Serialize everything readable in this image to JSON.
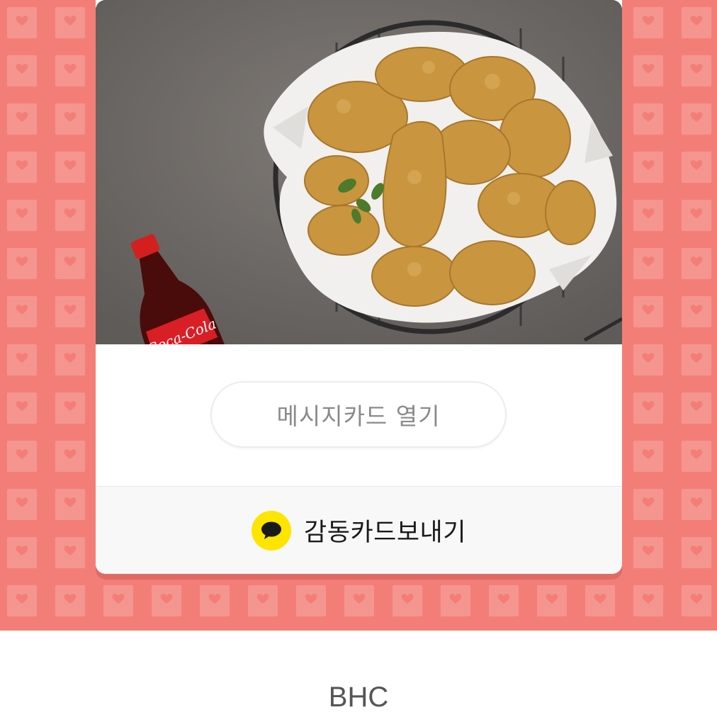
{
  "card": {
    "photo_label": "Coca-Cola",
    "open_button_label": "메시지카드 열기",
    "send_button_label": "감동카드보내기",
    "send_icon": "kakaotalk-speech-bubble-icon"
  },
  "footer": {
    "brand": "BHC"
  },
  "colors": {
    "background_pattern": "#f37e78",
    "kakao_yellow": "#fee500",
    "card_white": "#ffffff"
  }
}
